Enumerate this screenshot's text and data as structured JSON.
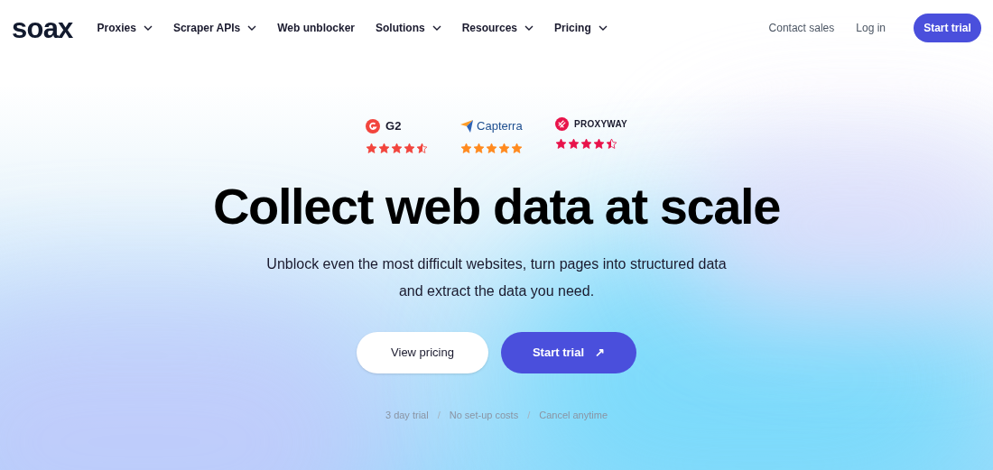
{
  "logo": "soax",
  "nav": [
    {
      "label": "Proxies",
      "dropdown": true
    },
    {
      "label": "Scraper APIs",
      "dropdown": true
    },
    {
      "label": "Web unblocker",
      "dropdown": false
    },
    {
      "label": "Solutions",
      "dropdown": true
    },
    {
      "label": "Resources",
      "dropdown": true
    },
    {
      "label": "Pricing",
      "dropdown": true
    }
  ],
  "header_actions": {
    "contact": "Contact sales",
    "login": "Log in",
    "cta": "Start trial"
  },
  "ratings": [
    {
      "kind": "g2",
      "name": "G2",
      "stars": 4.5,
      "color": "#f2453d"
    },
    {
      "kind": "capterra",
      "name": "Capterra",
      "stars": 5,
      "color": "#ff8a1f"
    },
    {
      "kind": "proxyway",
      "name": "PROXYWAY",
      "stars": 4.5,
      "color": "#e8134a"
    }
  ],
  "headline": "Collect web data at scale",
  "subtitle_lines": [
    "Unblock even the most difficult websites, turn pages into structured data",
    "and extract the data you need."
  ],
  "buttons": {
    "secondary": "View pricing",
    "primary": "Start trial",
    "primary_icon": "↗"
  },
  "notes": [
    {
      "kind": "text",
      "text": "3 day trial"
    },
    {
      "kind": "separator",
      "text": "/"
    },
    {
      "kind": "text",
      "text": "No set-up costs"
    },
    {
      "kind": "separator",
      "text": "/"
    },
    {
      "kind": "text",
      "text": "Cancel anytime"
    }
  ]
}
